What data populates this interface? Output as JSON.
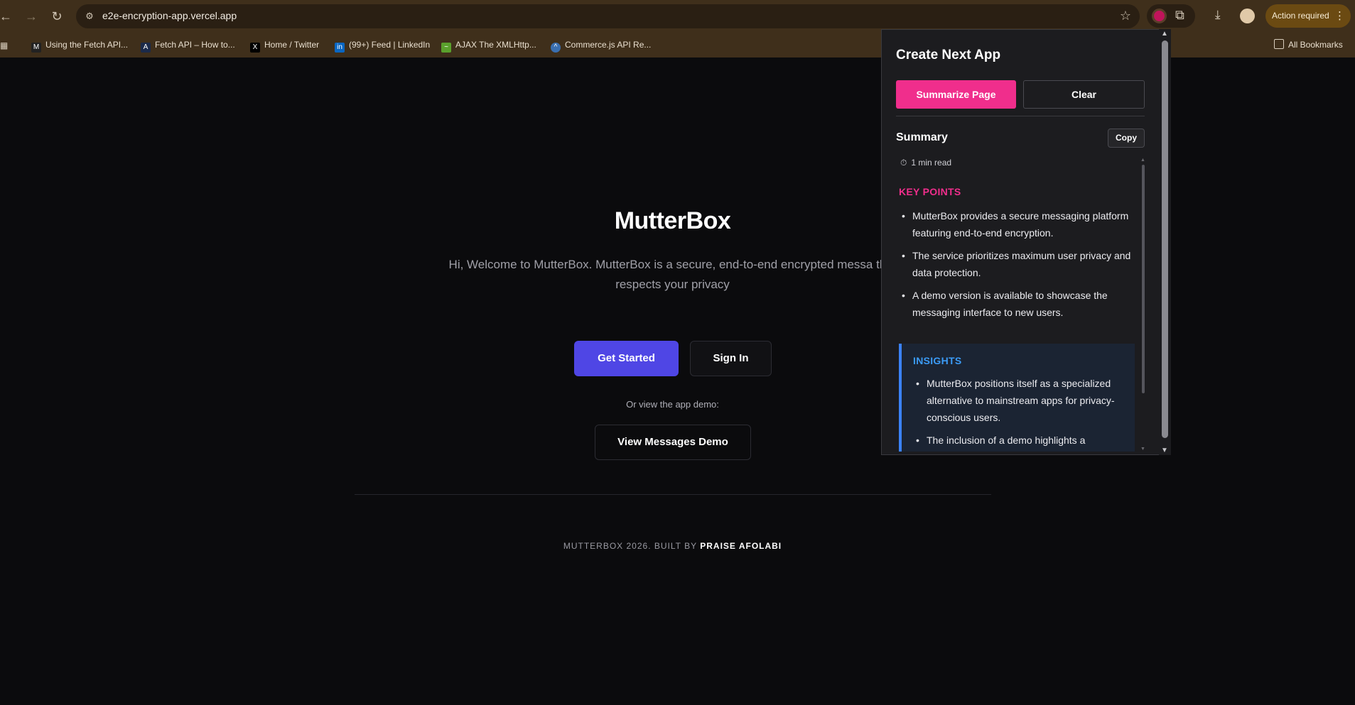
{
  "browser": {
    "url": "e2e-encryption-app.vercel.app",
    "action_required": "Action required",
    "bookmarks": [
      {
        "label": "Using the Fetch API...",
        "icon": "M"
      },
      {
        "label": "Fetch API – How to...",
        "icon": "A"
      },
      {
        "label": "Home / Twitter",
        "icon": "X"
      },
      {
        "label": "(99+) Feed | LinkedIn",
        "icon": "in"
      },
      {
        "label": "AJAX The XMLHttp...",
        "icon": "~"
      },
      {
        "label": "Commerce.js API Re...",
        "icon": "^"
      }
    ],
    "all_bookmarks": "All Bookmarks"
  },
  "page": {
    "title": "MutterBox",
    "subtitle": "Hi, Welcome to MutterBox. MutterBox is a secure, end-to-end encrypted messa that respects your privacy",
    "get_started": "Get Started",
    "sign_in": "Sign In",
    "demo_label": "Or view the app demo:",
    "demo_button": "View Messages Demo",
    "footer_prefix": "MUTTERBOX 2026. BUILT BY",
    "footer_author": "PRAISE AFOLABI"
  },
  "popup": {
    "title": "Create Next App",
    "summarize_button": "Summarize Page",
    "clear_button": "Clear",
    "summary_heading": "Summary",
    "copy_button": "Copy",
    "read_time": "1 min read",
    "key_points_heading": "KEY POINTS",
    "key_points": [
      "MutterBox provides a secure messaging platform featuring end-to-end encryption.",
      "The service prioritizes maximum user privacy and data protection.",
      "A demo version is available to showcase the messaging interface to new users."
    ],
    "insights_heading": "INSIGHTS",
    "insights": [
      "MutterBox positions itself as a specialized alternative to mainstream apps for privacy-conscious users.",
      "The inclusion of a demo highlights a"
    ]
  },
  "colors": {
    "accent_pink": "#f02e8c",
    "primary_indigo": "#4f46e5",
    "insight_blue": "#3b82f6"
  }
}
